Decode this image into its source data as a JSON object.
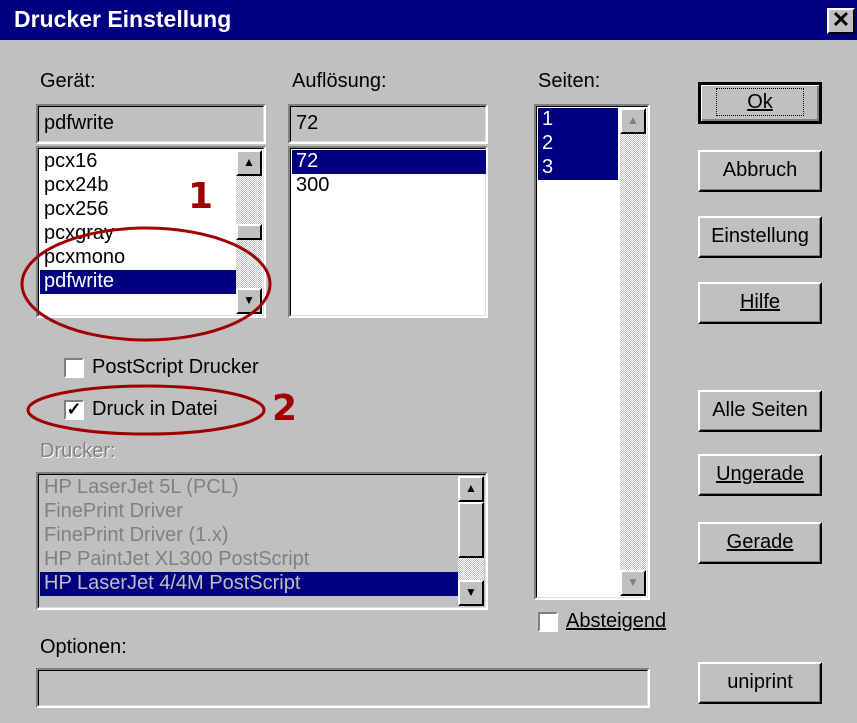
{
  "window": {
    "title": "Drucker Einstellung",
    "close_glyph": "✕"
  },
  "device": {
    "label": "Gerät:",
    "value": "pdfwrite",
    "items": [
      "pcx16",
      "pcx24b",
      "pcx256",
      "pcxgray",
      "pcxmono",
      "pdfwrite"
    ],
    "selected": "pdfwrite"
  },
  "resolution": {
    "label": "Auflösung:",
    "value": "72",
    "items": [
      "72",
      "300"
    ],
    "selected": "72"
  },
  "pages": {
    "label": "Seiten:",
    "items": [
      "1",
      "2",
      "3"
    ],
    "selected": [
      "1",
      "2",
      "3"
    ]
  },
  "checkboxes": {
    "postscript": {
      "label": "PostScript Drucker",
      "checked": false
    },
    "print_to_file": {
      "label": "Druck in Datei",
      "checked": true
    },
    "descending": {
      "label": "Absteigend",
      "checked": false
    }
  },
  "printer": {
    "label": "Drucker:",
    "items": [
      "HP LaserJet 5L (PCL)",
      "FinePrint Driver",
      "FinePrint Driver (1.x)",
      "HP PaintJet XL300 PostScript",
      "HP LaserJet 4/4M PostScript"
    ],
    "selected": "HP LaserJet 4/4M PostScript",
    "disabled": true
  },
  "options": {
    "label": "Optionen:",
    "value": ""
  },
  "buttons": {
    "ok": "Ok",
    "cancel": "Abbruch",
    "settings": "Einstellung",
    "help": "Hilfe",
    "all_pages": "Alle Seiten",
    "odd": "Ungerade",
    "even": "Gerade",
    "uniprint": "uniprint"
  },
  "annotations": {
    "one": "1",
    "two": "2"
  },
  "colors": {
    "title_bar": "#000080",
    "selection": "#000080",
    "annotation": "#a00000"
  }
}
